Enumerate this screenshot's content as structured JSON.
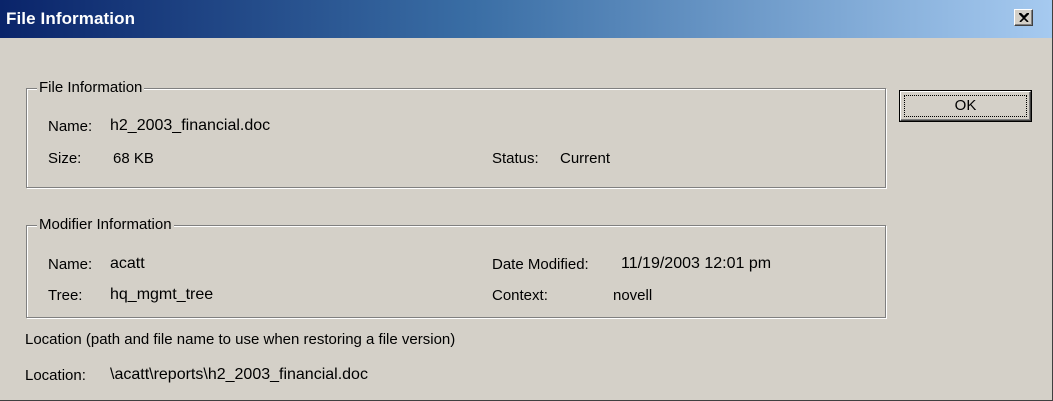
{
  "window": {
    "title": "File Information",
    "close_label": "Close",
    "titlebar_gradient": [
      "#0a246a",
      "#a6caf0"
    ],
    "face_color": "#d4d0c8"
  },
  "file_info": {
    "group_label": "File Information",
    "name_label": "Name:",
    "name_value": "h2_2003_financial.doc",
    "size_label": "Size:",
    "size_value": "68 KB",
    "status_label": "Status:",
    "status_value": "Current"
  },
  "modifier_info": {
    "group_label": "Modifier Information",
    "name_label": "Name:",
    "name_value": "acatt",
    "tree_label": "Tree:",
    "tree_value": "hq_mgmt_tree",
    "date_label": "Date Modified:",
    "date_value": "11/19/2003 12:01 pm",
    "context_label": "Context:",
    "context_value": "novell"
  },
  "location": {
    "description": "Location (path and file name to use when restoring a file version)",
    "label": "Location:",
    "value": "\\acatt\\reports\\h2_2003_financial.doc"
  },
  "buttons": {
    "ok_label": "OK"
  }
}
